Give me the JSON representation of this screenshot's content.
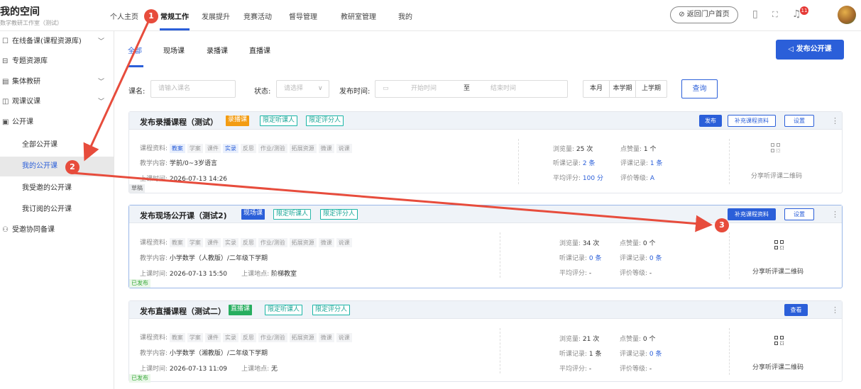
{
  "header": {
    "title": "我的空间",
    "subtitle": "数学教研工作室（测试）",
    "nav": [
      "个人主页",
      "常规工作",
      "发展提升",
      "竞赛活动",
      "督导管理",
      "教研室管理",
      "我的"
    ],
    "return_btn": "返回门户首页",
    "bell_count": "11"
  },
  "sidebar": {
    "items": [
      {
        "label": "在线备课(课程资源库)",
        "icon": "doc-icon",
        "chev": "﹀"
      },
      {
        "label": "专题资源库",
        "icon": "folder-icon",
        "chev": ""
      },
      {
        "label": "集体教研",
        "icon": "list-icon",
        "chev": "﹀"
      },
      {
        "label": "观课议课",
        "icon": "eye-icon",
        "chev": "﹀"
      },
      {
        "label": "公开课",
        "icon": "play-icon",
        "chev": ""
      }
    ],
    "sub_items": [
      "全部公开课",
      "我的公开课",
      "我受邀的公开课",
      "我订阅的公开课"
    ],
    "last_item": "受邀协同备课"
  },
  "tabs": [
    "全部",
    "现场课",
    "录播课",
    "直播课"
  ],
  "publish_btn": "发布公开课",
  "filters": {
    "name_label": "课名:",
    "name_placeholder": "请输入课名",
    "status_label": "状态:",
    "status_placeholder": "请选择",
    "time_label": "发布时间:",
    "start_placeholder": "开始时间",
    "to": "至",
    "end_placeholder": "结束时间",
    "ranges": [
      "本月",
      "本学期",
      "上学期"
    ],
    "query": "查询"
  },
  "cards": [
    {
      "title": "发布录播课程（测试）",
      "type_badge": "录播课",
      "type_color": "#f39c12",
      "limit_badges": [
        "限定听课人",
        "限定评分人"
      ],
      "buttons": [
        "发布",
        "补充课程资料",
        "设置"
      ],
      "materials_label": "课程资料:",
      "materials": [
        "教案",
        "学案",
        "课件",
        "实录",
        "反思",
        "作业/测验",
        "拓展资源",
        "微课",
        "说课"
      ],
      "materials_on": [
        0,
        3
      ],
      "content_label": "教学内容:",
      "content": "学前/0~3岁语言",
      "time_label": "上课时间:",
      "time": "2026-07-13 14:26",
      "place_label": "",
      "place": "",
      "views": "浏览量: ",
      "views_n": "25 次",
      "likes": "点赞量: ",
      "likes_n": "1 个",
      "listen": "听课记录: ",
      "listen_n": "2 条",
      "review": "评课记录: ",
      "review_n": "1 条",
      "avg": "平均评分: ",
      "avg_n": "100 分",
      "grade": "评价等级: ",
      "grade_n": "A",
      "qr_label": "分享听评课二维码",
      "status": "草稿"
    },
    {
      "title": "发布现场公开课（测试2)",
      "type_badge": "现场课",
      "type_color": "#2b5fd9",
      "limit_badges": [
        "限定听课人",
        "限定评分人"
      ],
      "buttons": [
        "补充课程资料",
        "设置"
      ],
      "materials_label": "课程资料:",
      "materials": [
        "教案",
        "学案",
        "课件",
        "实录",
        "反思",
        "作业/测验",
        "拓展资源",
        "微课",
        "说课"
      ],
      "materials_on": [],
      "content_label": "教学内容:",
      "content": "小学数学（人教版）/二年级下学期",
      "time_label": "上课时间:",
      "time": "2026-07-13 15:50",
      "place_label": "上课地点:",
      "place": "阶梯教室",
      "views": "浏览量: ",
      "views_n": "34 次",
      "likes": "点赞量: ",
      "likes_n": "0 个",
      "listen": "听课记录: ",
      "listen_n": "0 条",
      "review": "评课记录: ",
      "review_n": "0 条",
      "avg": "平均评分: ",
      "avg_n": "-",
      "grade": "评价等级: ",
      "grade_n": "-",
      "qr_label": "分享听评课二维码",
      "status": "已发布"
    },
    {
      "title": "发布直播课程（测试二）",
      "type_badge": "直播课",
      "type_color": "#27ae60",
      "limit_badges": [
        "限定听课人",
        "限定评分人"
      ],
      "buttons": [
        "查看"
      ],
      "materials_label": "课程资料:",
      "materials": [
        "教案",
        "学案",
        "课件",
        "实录",
        "反思",
        "作业/测验",
        "拓展资源",
        "微课",
        "说课"
      ],
      "materials_on": [],
      "content_label": "教学内容:",
      "content": "小学数学（湘教版）/二年级下学期",
      "time_label": "上课时间:",
      "time": "2026-07-13 11:09",
      "place_label": "上课地点:",
      "place": "无",
      "views": "浏览量: ",
      "views_n": "21 次",
      "likes": "点赞量: ",
      "likes_n": "0 个",
      "listen": "听课记录: ",
      "listen_n": "1 条",
      "review": "评课记录: ",
      "review_n": "0 条",
      "avg": "平均评分: ",
      "avg_n": "-",
      "grade": "评价等级: ",
      "grade_n": "-",
      "qr_label": "分享听评课二维码",
      "status": "已发布"
    }
  ],
  "markers": [
    "1",
    "2",
    "3"
  ],
  "colors": {
    "accent": "#2b5fd9",
    "marker": "#e74c3c"
  }
}
